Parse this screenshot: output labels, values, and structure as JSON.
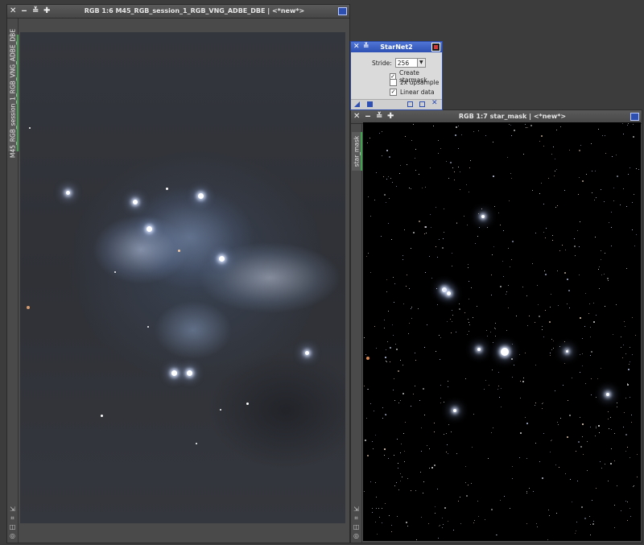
{
  "nebula_window": {
    "title": "RGB 1:6 M45_RGB_session_1_RGB_VNG_ADBE_DBE | <*new*>",
    "vertical_tab": "M45_RGB_session_1_RGB_VNG_ADBE_DBE",
    "buttons": {
      "close": "✕",
      "minimize": "‒",
      "shade": "≚",
      "maximize": "✚"
    }
  },
  "starmask_window": {
    "title": "RGB 1:7 star_mask | <*new*>",
    "vertical_tab": "star_mask",
    "buttons": {
      "close": "✕",
      "minimize": "‒",
      "shade": "≚",
      "maximize": "✚"
    }
  },
  "starnet_dialog": {
    "title": "StarNet2",
    "stride_label": "Stride:",
    "stride_value": "256",
    "options": [
      {
        "label": "Create starmask",
        "checked": true
      },
      {
        "label": "2x upsample",
        "checked": false
      },
      {
        "label": "Linear data",
        "checked": true
      }
    ]
  },
  "side_icons": [
    "⇲",
    "⌗",
    "◫",
    "◎"
  ],
  "colors": {
    "dialog_title": "#3a5ec6",
    "tab_accent": "#3fa34d",
    "workspace": "#3c3c3c"
  }
}
